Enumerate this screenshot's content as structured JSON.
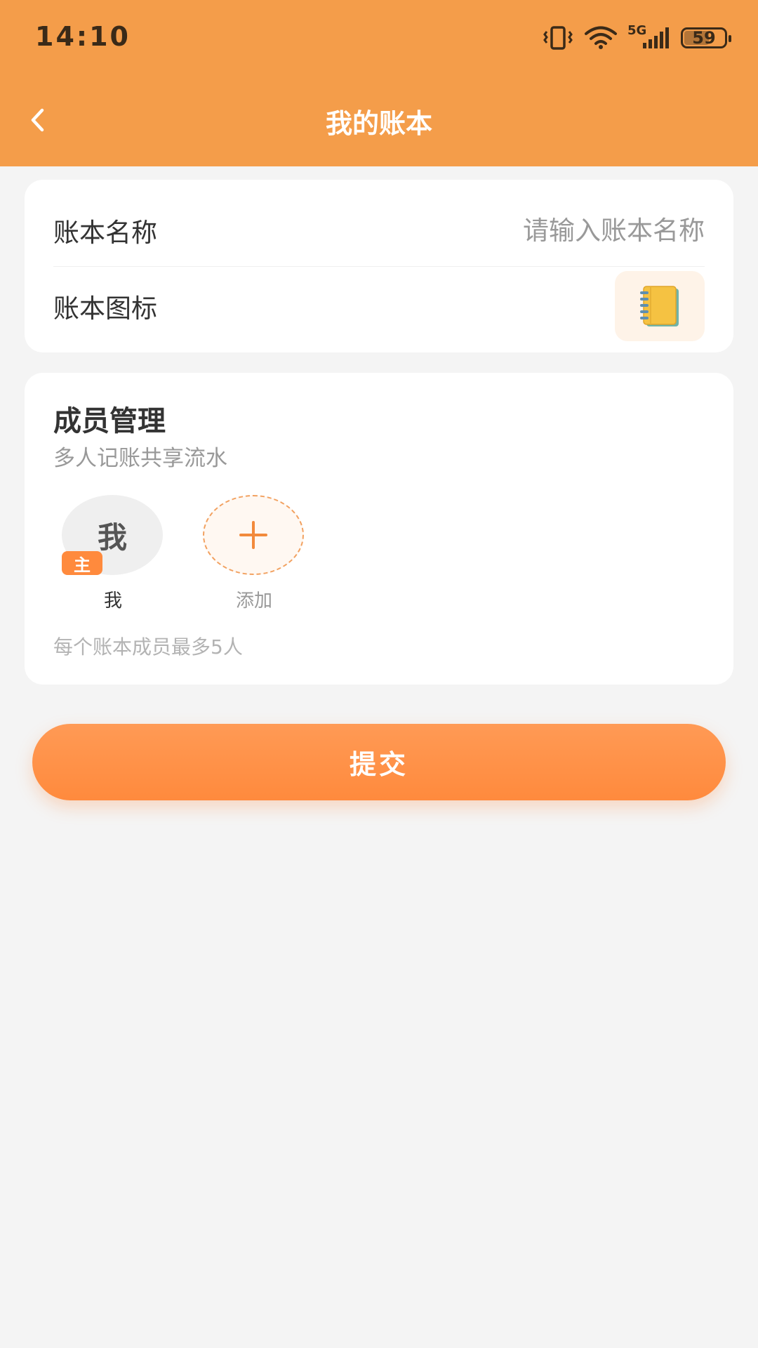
{
  "status_bar": {
    "time": "14:10",
    "network": "5G",
    "battery": "59",
    "battery_level": 0.59
  },
  "nav": {
    "back_icon": "chevron-left-icon",
    "title": "我的账本"
  },
  "ledger_form": {
    "name_label": "账本名称",
    "name_placeholder": "请输入账本名称",
    "name_value": "",
    "icon_label": "账本图标",
    "icon_name": "notebook-icon"
  },
  "members": {
    "title": "成员管理",
    "subtitle": "多人记账共享流水",
    "items": [
      {
        "avatar_text": "我",
        "badge": "主",
        "name": "我"
      }
    ],
    "add_label": "添加",
    "limit_note": "每个账本成员最多5人"
  },
  "submit": {
    "label": "提交"
  },
  "colors": {
    "header": "#f49d4a",
    "accent": "#ff8a3d",
    "background": "#f4f4f4"
  }
}
